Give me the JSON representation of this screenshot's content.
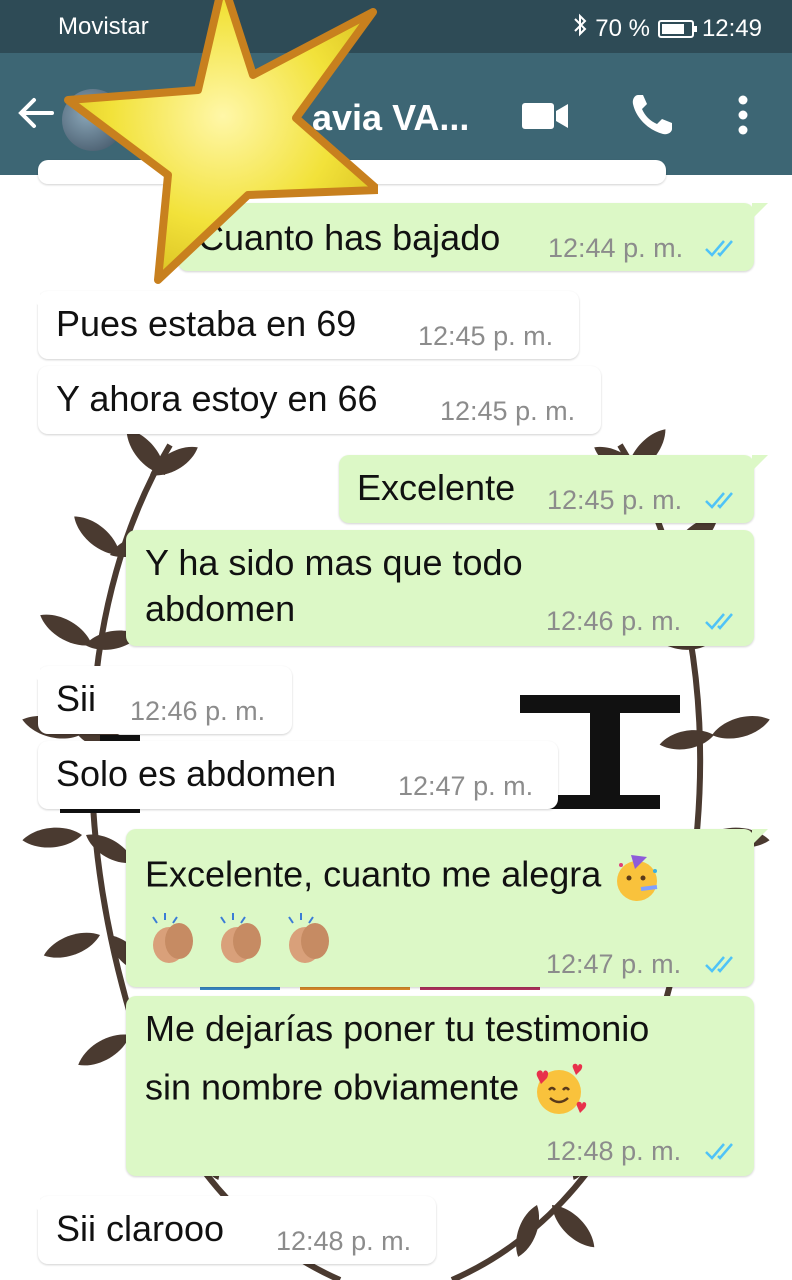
{
  "status_bar": {
    "carrier": "Movistar",
    "battery": "70 %",
    "time": "12:49"
  },
  "header": {
    "contact_name": "avia VA..."
  },
  "messages": [
    {
      "direction": "out",
      "text": "Cuanto has bajado",
      "time": "12:44 p. m.",
      "status": "read"
    },
    {
      "direction": "in",
      "text": "Pues estaba en 69",
      "time": "12:45 p. m."
    },
    {
      "direction": "in",
      "text": "Y ahora estoy en 66",
      "time": "12:45 p. m."
    },
    {
      "direction": "out",
      "text": "Excelente",
      "time": "12:45 p. m.",
      "status": "read"
    },
    {
      "direction": "out",
      "text_line1": "Y ha sido mas que todo",
      "text_line2": "abdomen",
      "time": "12:46 p. m.",
      "status": "read"
    },
    {
      "direction": "in",
      "text": "Sii",
      "time": "12:46 p. m."
    },
    {
      "direction": "in",
      "text": "Solo es abdomen",
      "time": "12:47 p. m."
    },
    {
      "direction": "out",
      "text": "Excelente, cuanto me alegra",
      "emojis": [
        "partying-face-emoji",
        "clapping-hands-emoji",
        "clapping-hands-emoji",
        "clapping-hands-emoji"
      ],
      "time": "12:47 p. m.",
      "status": "read"
    },
    {
      "direction": "out",
      "text_line1": "Me dejarías poner tu testimonio",
      "text_line2": "sin nombre obviamente",
      "emojis": [
        "smiling-face-with-hearts-emoji"
      ],
      "time": "12:48 p. m.",
      "status": "read"
    },
    {
      "direction": "in",
      "text": "Sii clarooo",
      "time": "12:48 p. m."
    }
  ],
  "colors": {
    "status_bar": "#2e4b56",
    "header": "#3d6674",
    "outgoing_bubble": "#dcf8c6",
    "incoming_bubble": "#ffffff",
    "read_ticks": "#4fc3f7",
    "star": "#f2e23a"
  }
}
